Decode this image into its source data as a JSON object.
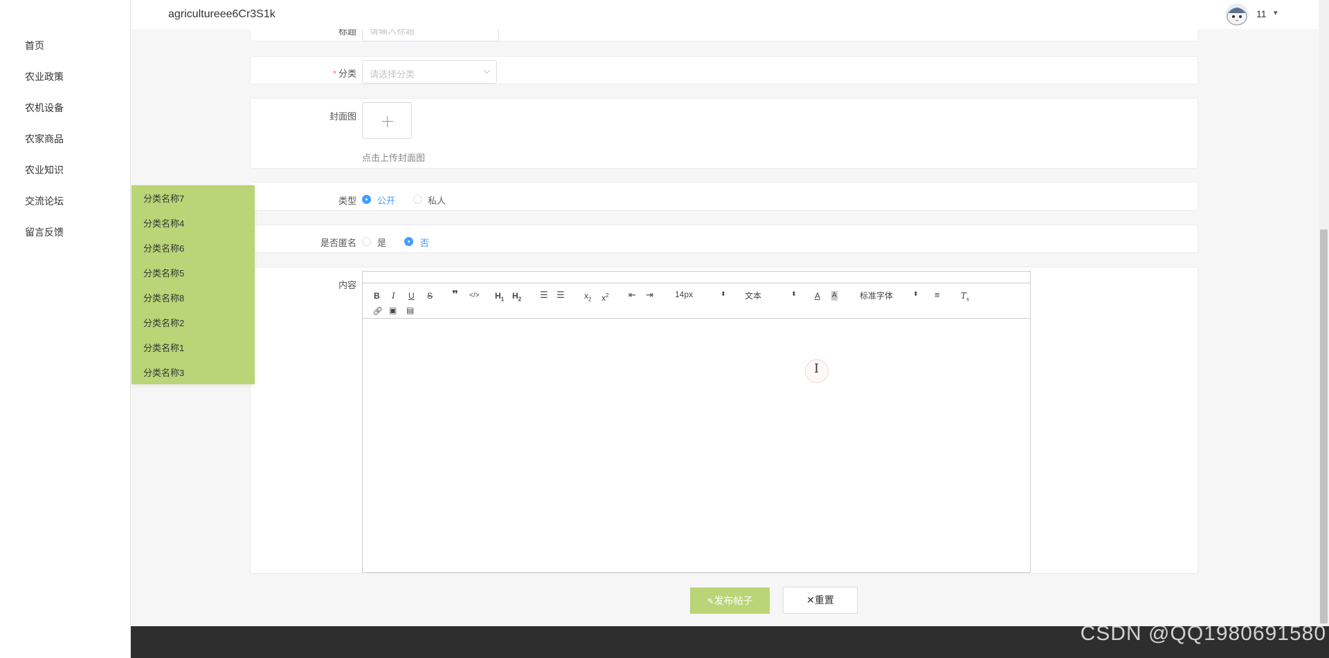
{
  "app": {
    "title": "agricultureee6Cr3S1k"
  },
  "user": {
    "name": "11",
    "caret": "▾"
  },
  "sidebar": {
    "items": [
      {
        "label": "首页"
      },
      {
        "label": "农业政策"
      },
      {
        "label": "农机设备"
      },
      {
        "label": "农家商品"
      },
      {
        "label": "农业知识"
      },
      {
        "label": "交流论坛"
      },
      {
        "label": "留言反馈"
      }
    ]
  },
  "form": {
    "title": {
      "label": "标题",
      "placeholder": "请输入标题"
    },
    "category": {
      "required_mark": "*",
      "label": "分类",
      "placeholder": "请选择分类"
    },
    "cover": {
      "label": "封面图",
      "tip": "点击上传封面图"
    },
    "type": {
      "label": "类型",
      "options": [
        "公开",
        "私人"
      ],
      "selected": "公开"
    },
    "anonymous": {
      "label": "是否匿名",
      "options": [
        "是",
        "否"
      ],
      "selected": "否"
    },
    "content": {
      "label": "内容"
    }
  },
  "category_dropdown": {
    "options": [
      "分类名称7",
      "分类名称4",
      "分类名称6",
      "分类名称5",
      "分类名称8",
      "分类名称2",
      "分类名称1",
      "分类名称3"
    ]
  },
  "editor": {
    "toolbar": {
      "font_size": "14px",
      "header": "文本",
      "font_family": "标准字体"
    }
  },
  "buttons": {
    "publish": "发布帖子",
    "reset": "重置"
  },
  "watermark": "CSDN @QQ1980691580",
  "colors": {
    "accent_green": "#b9d577",
    "radio_blue": "#409eff",
    "footer": "#2e2e2e"
  }
}
